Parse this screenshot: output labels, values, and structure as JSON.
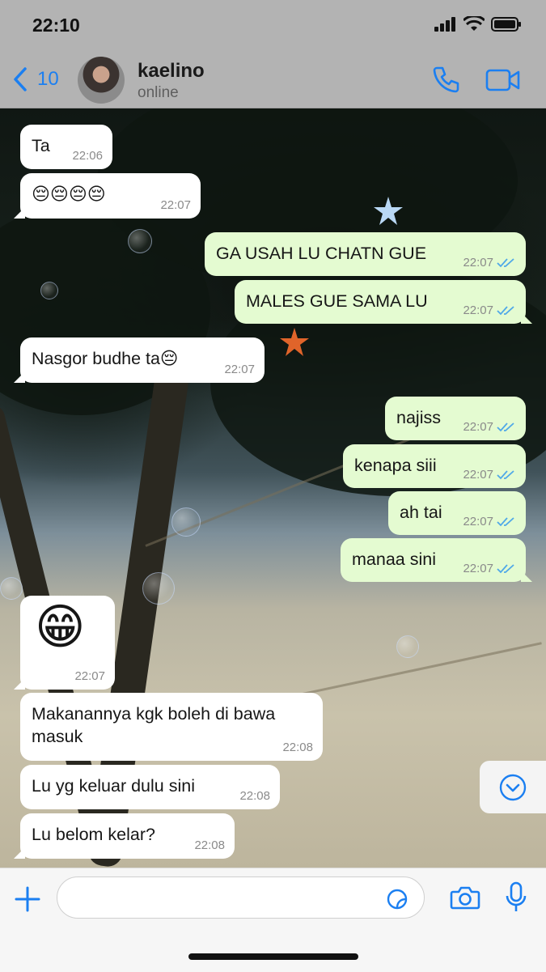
{
  "status_bar": {
    "time": "22:10"
  },
  "header": {
    "back_count": "10",
    "contact_name": "kaelino",
    "contact_status": "online"
  },
  "messages": [
    {
      "direction": "in",
      "text": "Ta",
      "time": "22:06"
    },
    {
      "direction": "in",
      "text": "😔😔😔😔",
      "time": "22:07"
    },
    {
      "direction": "out",
      "text": "GA USAH LU CHATN GUE",
      "time": "22:07",
      "read": true
    },
    {
      "direction": "out",
      "text": "MALES GUE SAMA LU",
      "time": "22:07",
      "read": true
    },
    {
      "direction": "in",
      "text": "Nasgor budhe ta😔",
      "time": "22:07"
    },
    {
      "direction": "out",
      "text": "najiss",
      "time": "22:07",
      "read": true
    },
    {
      "direction": "out",
      "text": "kenapa siii",
      "time": "22:07",
      "read": true
    },
    {
      "direction": "out",
      "text": "ah tai",
      "time": "22:07",
      "read": true
    },
    {
      "direction": "out",
      "text": "manaa sini",
      "time": "22:07",
      "read": true
    },
    {
      "direction": "in",
      "text": "😁",
      "time": "22:07"
    },
    {
      "direction": "in",
      "text": "Makanannya kgk boleh di bawa\nmasuk",
      "time": "22:08"
    },
    {
      "direction": "in",
      "text": "Lu yg keluar dulu sini",
      "time": "22:08"
    },
    {
      "direction": "in",
      "text": "Lu belom kelar?",
      "time": "22:08"
    }
  ],
  "input": {
    "placeholder": ""
  },
  "icons": {
    "back": "chevron-left-icon",
    "call": "phone-icon",
    "video": "video-camera-icon",
    "scroll_down": "chevron-down-circle-icon",
    "attach": "plus-icon",
    "sticker": "sticker-icon",
    "camera": "camera-icon",
    "mic": "microphone-icon",
    "read_receipt": "double-check-icon"
  },
  "colors": {
    "accent": "#1b7ff1",
    "outgoing_bubble": "#e4fbd1",
    "incoming_bubble": "#ffffff",
    "read_check": "#4fa8e8"
  }
}
